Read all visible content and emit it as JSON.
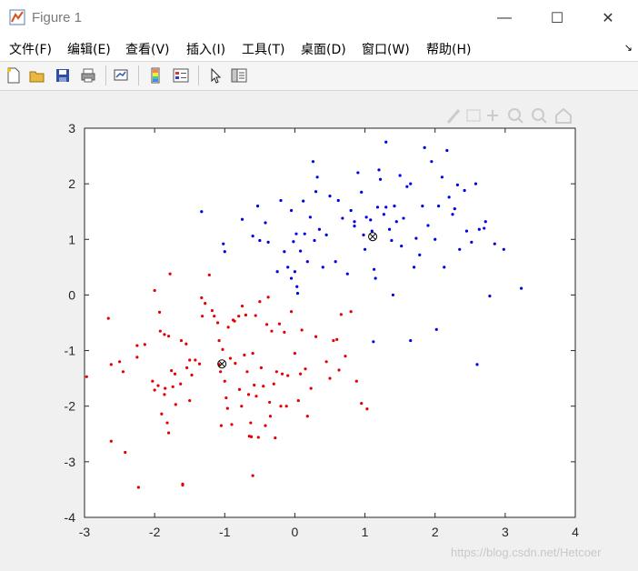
{
  "window": {
    "title": "Figure 1",
    "controls": {
      "minimize": "—",
      "maximize": "☐",
      "close": "✕"
    }
  },
  "menu": {
    "items": [
      "文件(F)",
      "编辑(E)",
      "查看(V)",
      "插入(I)",
      "工具(T)",
      "桌面(D)",
      "窗口(W)",
      "帮助(H)"
    ],
    "more_glyph": "↘"
  },
  "toolbar": {
    "buttons": [
      "new-figure-icon",
      "open-file-icon",
      "save-icon",
      "print-icon",
      "link-plot-icon",
      "colorbar-icon",
      "legend-icon",
      "pointer-icon",
      "property-editor-icon"
    ]
  },
  "axes_toolbar": {
    "buttons": [
      "brush-icon",
      "data-tips-icon",
      "pan-icon",
      "zoom-in-icon",
      "zoom-out-icon",
      "home-icon"
    ]
  },
  "watermark": "https://blog.csdn.net/Hetcoer",
  "colors": {
    "cluster1": "#e60000",
    "cluster2": "#0000e6",
    "centroid": "#000000",
    "axes_bg": "#ffffff"
  },
  "chart_data": {
    "type": "scatter",
    "xlim": [
      -3,
      4
    ],
    "ylim": [
      -4,
      3
    ],
    "xticks": [
      "-3",
      "-2",
      "-1",
      "0",
      "1",
      "2",
      "3",
      "4"
    ],
    "yticks": [
      "3",
      "2",
      "1",
      "0",
      "-1",
      "-2",
      "-3",
      "-4"
    ],
    "grid": false,
    "series": [
      {
        "color": "#e60000",
        "points": [
          [
            -2.97,
            -1.47
          ],
          [
            -2.66,
            -0.42
          ],
          [
            -2.62,
            -1.25
          ],
          [
            -2.5,
            -1.2
          ],
          [
            -2.45,
            -1.38
          ],
          [
            -2.42,
            -2.83
          ],
          [
            -2.62,
            -2.63
          ],
          [
            -2.25,
            -1.12
          ],
          [
            -2.25,
            -0.91
          ],
          [
            -2.23,
            -3.46
          ],
          [
            -2.14,
            -0.89
          ],
          [
            -2.03,
            -1.55
          ],
          [
            -2.0,
            0.08
          ],
          [
            -2.0,
            -1.71
          ],
          [
            -1.95,
            -1.63
          ],
          [
            -1.93,
            -0.31
          ],
          [
            -1.92,
            -0.65
          ],
          [
            -1.9,
            -2.14
          ],
          [
            -1.86,
            -1.79
          ],
          [
            -1.86,
            -0.71
          ],
          [
            -1.85,
            -1.68
          ],
          [
            -1.82,
            -2.3
          ],
          [
            -1.8,
            -2.48
          ],
          [
            -1.8,
            -0.74
          ],
          [
            -1.78,
            0.38
          ],
          [
            -1.76,
            -1.36
          ],
          [
            -1.74,
            -1.65
          ],
          [
            -1.71,
            -1.42
          ],
          [
            -1.7,
            -1.97
          ],
          [
            -1.63,
            -1.6
          ],
          [
            -1.62,
            -0.82
          ],
          [
            -1.6,
            -3.4
          ],
          [
            -1.55,
            -0.88
          ],
          [
            -1.54,
            -1.31
          ],
          [
            -1.5,
            -1.9
          ],
          [
            -1.5,
            -1.17
          ],
          [
            -1.47,
            -1.44
          ],
          [
            -1.42,
            -1.17
          ],
          [
            -1.36,
            -1.24
          ],
          [
            -1.33,
            -0.05
          ],
          [
            -1.32,
            -0.38
          ],
          [
            -1.28,
            -0.15
          ],
          [
            -1.22,
            0.36
          ],
          [
            -1.18,
            -0.28
          ],
          [
            -1.15,
            -0.38
          ],
          [
            -1.1,
            -0.5
          ],
          [
            -1.08,
            -0.82
          ],
          [
            -1.08,
            -1.25
          ],
          [
            -1.06,
            -1.38
          ],
          [
            -1.05,
            -2.35
          ],
          [
            -1.03,
            -0.98
          ],
          [
            -1.0,
            -1.55
          ],
          [
            -0.98,
            -1.85
          ],
          [
            -0.96,
            -2.04
          ],
          [
            -0.95,
            -0.58
          ],
          [
            -0.92,
            -1.14
          ],
          [
            -0.9,
            -2.33
          ],
          [
            -0.88,
            -0.45
          ],
          [
            -0.86,
            -0.47
          ],
          [
            -0.85,
            -1.23
          ],
          [
            -0.8,
            -0.38
          ],
          [
            -0.79,
            -1.7
          ],
          [
            -0.76,
            -2.0
          ],
          [
            -0.75,
            -0.2
          ],
          [
            -0.72,
            -1.08
          ],
          [
            -0.7,
            -0.36
          ],
          [
            -0.68,
            -1.38
          ],
          [
            -0.66,
            -1.79
          ],
          [
            -0.65,
            -2.54
          ],
          [
            -0.63,
            -2.3
          ],
          [
            -0.6,
            -1.05
          ],
          [
            -0.58,
            -1.62
          ],
          [
            -0.56,
            -0.37
          ],
          [
            -0.55,
            -1.82
          ],
          [
            -0.52,
            -2.56
          ],
          [
            -0.5,
            -0.12
          ],
          [
            -0.48,
            -1.31
          ],
          [
            -0.45,
            -1.64
          ],
          [
            -0.42,
            -2.35
          ],
          [
            -0.4,
            -0.53
          ],
          [
            -0.38,
            -0.04
          ],
          [
            -0.36,
            -1.93
          ],
          [
            -0.35,
            -2.18
          ],
          [
            -0.33,
            -0.65
          ],
          [
            -0.3,
            -1.6
          ],
          [
            -0.28,
            -2.57
          ],
          [
            -0.26,
            -1.38
          ],
          [
            -0.22,
            -0.52
          ],
          [
            -0.2,
            -2.0
          ],
          [
            -0.18,
            -1.42
          ],
          [
            -0.15,
            -0.67
          ],
          [
            -0.12,
            -2.0
          ],
          [
            -0.1,
            -1.45
          ],
          [
            -0.05,
            -0.3
          ],
          [
            0.0,
            -1.05
          ],
          [
            0.05,
            -1.9
          ],
          [
            0.08,
            -1.42
          ],
          [
            0.1,
            -0.63
          ],
          [
            0.15,
            -1.33
          ],
          [
            0.18,
            -2.18
          ],
          [
            0.23,
            -1.68
          ],
          [
            0.3,
            -0.75
          ],
          [
            0.45,
            -1.2
          ],
          [
            0.5,
            -1.5
          ],
          [
            0.55,
            -0.82
          ],
          [
            0.6,
            -0.8
          ],
          [
            0.63,
            -1.35
          ],
          [
            0.66,
            -0.35
          ],
          [
            0.72,
            -1.1
          ],
          [
            0.8,
            -0.3
          ],
          [
            0.88,
            -1.55
          ],
          [
            0.95,
            -1.95
          ],
          [
            1.03,
            -2.05
          ],
          [
            -0.6,
            -3.25
          ],
          [
            -0.62,
            -2.55
          ],
          [
            -1.6,
            -3.42
          ]
        ]
      },
      {
        "color": "#0000e6",
        "points": [
          [
            -1.33,
            1.5
          ],
          [
            -1.02,
            0.92
          ],
          [
            -1.0,
            0.78
          ],
          [
            -0.75,
            1.36
          ],
          [
            -0.6,
            1.06
          ],
          [
            -0.53,
            1.6
          ],
          [
            -0.5,
            0.98
          ],
          [
            -0.42,
            1.3
          ],
          [
            -0.38,
            0.95
          ],
          [
            -0.25,
            0.42
          ],
          [
            -0.2,
            1.7
          ],
          [
            -0.15,
            0.78
          ],
          [
            -0.1,
            0.5
          ],
          [
            -0.05,
            1.52
          ],
          [
            -0.05,
            0.3
          ],
          [
            -0.02,
            0.96
          ],
          [
            0.0,
            0.42
          ],
          [
            0.02,
            1.1
          ],
          [
            0.03,
            0.15
          ],
          [
            0.04,
            0.03
          ],
          [
            0.08,
            0.79
          ],
          [
            0.12,
            1.69
          ],
          [
            0.14,
            1.1
          ],
          [
            0.18,
            0.6
          ],
          [
            0.22,
            1.4
          ],
          [
            0.26,
            2.4
          ],
          [
            0.28,
            0.98
          ],
          [
            0.3,
            1.86
          ],
          [
            0.32,
            2.12
          ],
          [
            0.35,
            1.18
          ],
          [
            0.4,
            0.5
          ],
          [
            0.45,
            1.08
          ],
          [
            0.5,
            1.78
          ],
          [
            0.58,
            0.6
          ],
          [
            0.62,
            1.7
          ],
          [
            0.68,
            1.38
          ],
          [
            0.75,
            0.38
          ],
          [
            0.8,
            1.52
          ],
          [
            0.85,
            1.32
          ],
          [
            0.9,
            2.2
          ],
          [
            0.95,
            1.85
          ],
          [
            0.98,
            1.08
          ],
          [
            1.0,
            0.82
          ],
          [
            1.02,
            1.4
          ],
          [
            1.08,
            1.35
          ],
          [
            1.1,
            1.15
          ],
          [
            1.13,
            0.46
          ],
          [
            1.15,
            0.3
          ],
          [
            1.18,
            1.58
          ],
          [
            1.2,
            2.25
          ],
          [
            1.22,
            2.08
          ],
          [
            1.27,
            1.45
          ],
          [
            1.3,
            2.75
          ],
          [
            1.35,
            1.18
          ],
          [
            1.38,
            0.98
          ],
          [
            1.4,
            0.0
          ],
          [
            1.42,
            1.6
          ],
          [
            1.45,
            1.32
          ],
          [
            1.5,
            2.15
          ],
          [
            1.52,
            0.88
          ],
          [
            1.55,
            1.38
          ],
          [
            1.6,
            1.95
          ],
          [
            1.65,
            2.0
          ],
          [
            1.7,
            0.5
          ],
          [
            1.73,
            1.02
          ],
          [
            1.78,
            0.72
          ],
          [
            1.82,
            1.6
          ],
          [
            1.85,
            2.65
          ],
          [
            1.9,
            1.25
          ],
          [
            1.95,
            2.4
          ],
          [
            2.0,
            1.0
          ],
          [
            2.05,
            1.6
          ],
          [
            2.1,
            2.12
          ],
          [
            2.13,
            0.5
          ],
          [
            2.17,
            2.6
          ],
          [
            2.2,
            1.76
          ],
          [
            2.25,
            1.45
          ],
          [
            2.28,
            1.55
          ],
          [
            2.32,
            1.98
          ],
          [
            2.35,
            0.82
          ],
          [
            2.42,
            1.88
          ],
          [
            2.45,
            1.15
          ],
          [
            2.52,
            0.95
          ],
          [
            2.58,
            2.0
          ],
          [
            2.63,
            1.18
          ],
          [
            2.7,
            1.2
          ],
          [
            2.72,
            1.32
          ],
          [
            2.78,
            -0.02
          ],
          [
            2.85,
            0.92
          ],
          [
            2.98,
            0.82
          ],
          [
            3.23,
            0.12
          ],
          [
            2.6,
            -1.25
          ],
          [
            1.65,
            -0.82
          ],
          [
            1.12,
            -0.84
          ],
          [
            2.02,
            -0.62
          ],
          [
            1.3,
            1.58
          ],
          [
            0.85,
            1.24
          ]
        ]
      }
    ],
    "centroids": [
      [
        -1.04,
        -1.24
      ],
      [
        1.11,
        1.05
      ]
    ]
  }
}
